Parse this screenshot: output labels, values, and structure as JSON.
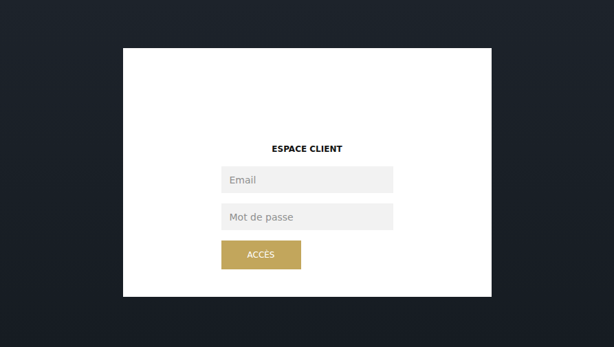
{
  "login": {
    "title": "ESPACE CLIENT",
    "fields": [
      {
        "name": "email",
        "placeholder": "Email",
        "type": "email"
      },
      {
        "name": "password",
        "placeholder": "Mot de passe",
        "type": "password"
      }
    ],
    "submit": "ACCÈS"
  }
}
